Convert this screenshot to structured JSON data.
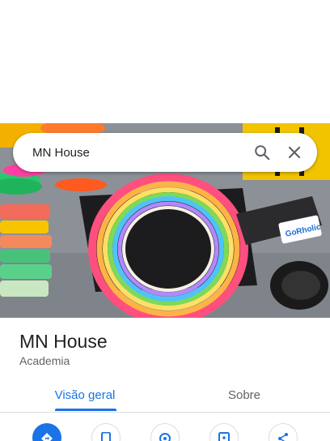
{
  "search": {
    "query": "MN House"
  },
  "place": {
    "name": "MN House",
    "category": "Academia"
  },
  "tabs": [
    {
      "label": "Visão geral",
      "active": true
    },
    {
      "label": "Sobre",
      "active": false
    }
  ],
  "actions": [
    {
      "icon": "directions-icon"
    },
    {
      "icon": "phone-icon"
    },
    {
      "icon": "location-icon"
    },
    {
      "icon": "save-icon"
    },
    {
      "icon": "share-icon"
    }
  ],
  "photo": {
    "label_text": "GoRholic"
  },
  "colors": {
    "accent": "#1a73e8",
    "text": "#202124",
    "secondary": "#5f6368",
    "divider": "#dadce0"
  }
}
